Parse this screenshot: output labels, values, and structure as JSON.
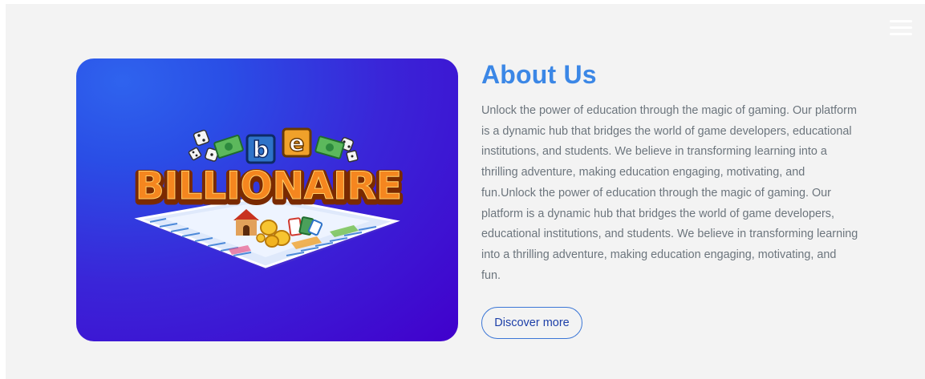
{
  "header": {
    "menu_icon": "hamburger-menu-icon"
  },
  "hero": {
    "logo_letters": [
      "b",
      "e"
    ],
    "logo_word": "BILLIONAIRE",
    "colors": {
      "gradient_start": "#2f63ee",
      "gradient_end": "#4100cc",
      "logo_orange": "#f5861f",
      "logo_outline": "#7a2a00",
      "tile_blue": "#2e73c9",
      "tile_orange": "#f0a12a"
    }
  },
  "about": {
    "title": "About Us",
    "body": "Unlock the power of education through the magic of gaming. Our platform is a dynamic hub that bridges the world of game developers, educational institutions, and students. We believe in transforming learning into a thrilling adventure, making education engaging, motivating, and fun.Unlock the power of education through the magic of gaming. Our platform is a dynamic hub that bridges the world of game developers, educational institutions, and students. We believe in transforming learning into a thrilling adventure, making education engaging, motivating, and fun.",
    "button_label": "Discover more"
  },
  "colors": {
    "page_background": "#f3f3f3",
    "title_blue": "#3b87e6",
    "body_gray": "#6c757d",
    "button_border": "#3b76d6"
  }
}
